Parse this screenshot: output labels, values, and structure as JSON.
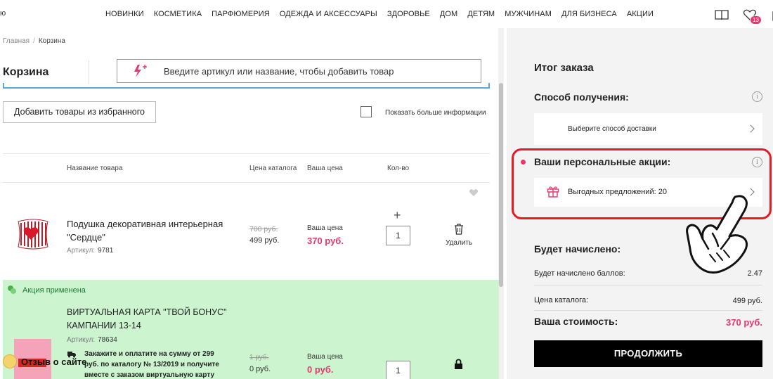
{
  "header": {
    "logo_fragment": "ю",
    "menu": [
      "НОВИНКИ",
      "КОСМЕТИКА",
      "ПАРФЮМЕРИЯ",
      "ОДЕЖДА И АКСЕССУАРЫ",
      "ЗДОРОВЬЕ",
      "ДОМ",
      "ДЕТЯМ",
      "МУЖЧИНАМ",
      "ДЛЯ БИЗНЕСА",
      "АКЦИИ"
    ],
    "favorites_count": "13",
    "icons": [
      "catalog-book-icon",
      "favorites-heart-icon",
      "cart-bag-icon"
    ]
  },
  "breadcrumb": {
    "home": "Главная",
    "separator": "/",
    "current": "Корзина"
  },
  "cart": {
    "title": "Корзина",
    "add_placeholder": "Введите артикул или название, чтобы добавить товар",
    "add_from_favorites": "Добавить товары из избранного",
    "show_more_info": "Показать больше информации",
    "columns": {
      "name": "Название товара",
      "catalog_price": "Цена каталога",
      "your_price": "Ваша цена",
      "qty": "Кол-во"
    }
  },
  "items": [
    {
      "name": "Подушка декоративная интерьерная \"Сердце\"",
      "article_label": "Артикул:",
      "article": "9781",
      "old_price": "700 руб.",
      "catalog_price": "499 руб.",
      "your_price_label": "Ваша цена",
      "your_price": "370 руб.",
      "qty": "1",
      "plus": "+",
      "delete_label": "Удалить"
    },
    {
      "promo_label": "Акция применена",
      "name": "ВИРТУАЛЬНАЯ КАРТА \"ТВОЙ БОНУС\" КАМПАНИИ 13-14",
      "article_label": "Артикул:",
      "article": "78634",
      "note": "Закажите и оплатите на сумму от 299 руб. по каталогу № 13/2019 и получите вместе с заказом виртуальную карту",
      "old_price": "1 руб.",
      "catalog_price": "0 руб.",
      "your_price_label": "Ваша цена",
      "your_price": "0 руб.",
      "qty": "1"
    }
  ],
  "review_widget": {
    "label": "Отзыв о сайте"
  },
  "summary": {
    "title": "Итог заказа",
    "delivery_heading": "Способ получения:",
    "delivery_choose": "Выберите способ доставки",
    "promo_heading": "Ваши персональные акции:",
    "offers_label": "Выгодных предложений: 20",
    "earn_heading": "Будет начислено:",
    "points_label": "Будет начислено баллов:",
    "points_value": "2.47",
    "catalog_label": "Цена каталога:",
    "catalog_value": "499 руб.",
    "total_label": "Ваша стоимость:",
    "total_value": "370 руб.",
    "continue": "ПРОДОЛЖИТЬ",
    "info_glyph": "i"
  },
  "colors": {
    "accent_pink": "#e6396c",
    "promo_green": "#ccf5cf",
    "highlight_red": "#e31b23",
    "button_black": "#000000"
  }
}
